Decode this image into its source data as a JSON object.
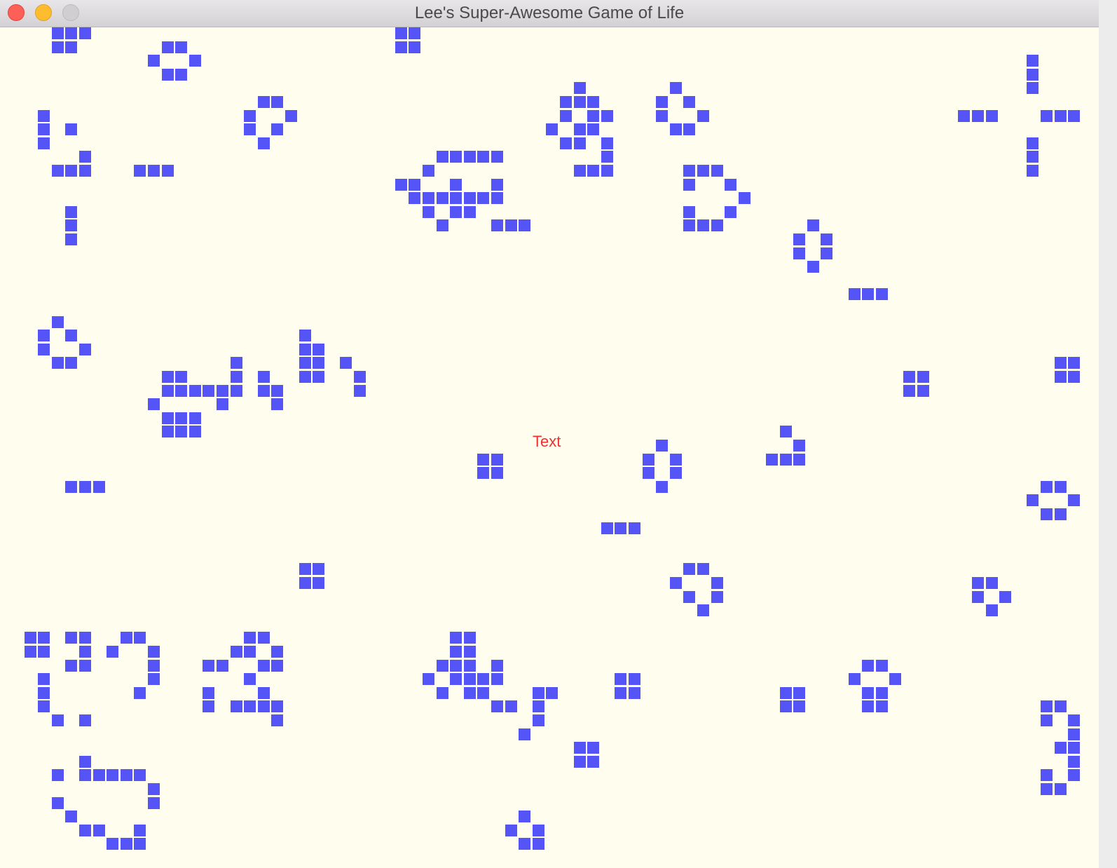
{
  "window": {
    "title": "Lee's Super-Awesome Game of Life"
  },
  "board": {
    "label_text": "Text",
    "background_color": "#fffeee",
    "cell_color": "#5555f7",
    "label_color": "#f03030",
    "live_cells": [
      [
        3,
        0
      ],
      [
        4,
        0
      ],
      [
        5,
        0
      ],
      [
        3,
        1
      ],
      [
        4,
        1
      ],
      [
        28,
        0
      ],
      [
        29,
        0
      ],
      [
        28,
        1
      ],
      [
        29,
        1
      ],
      [
        11,
        1
      ],
      [
        12,
        1
      ],
      [
        10,
        2
      ],
      [
        13,
        2
      ],
      [
        11,
        3
      ],
      [
        12,
        3
      ],
      [
        74,
        2
      ],
      [
        74,
        3
      ],
      [
        74,
        4
      ],
      [
        41,
        4
      ],
      [
        48,
        4
      ],
      [
        18,
        5
      ],
      [
        19,
        5
      ],
      [
        40,
        5
      ],
      [
        41,
        5
      ],
      [
        42,
        5
      ],
      [
        47,
        5
      ],
      [
        49,
        5
      ],
      [
        2,
        6
      ],
      [
        17,
        6
      ],
      [
        20,
        6
      ],
      [
        40,
        6
      ],
      [
        42,
        6
      ],
      [
        43,
        6
      ],
      [
        47,
        6
      ],
      [
        50,
        6
      ],
      [
        69,
        6
      ],
      [
        70,
        6
      ],
      [
        71,
        6
      ],
      [
        75,
        6
      ],
      [
        76,
        6
      ],
      [
        77,
        6
      ],
      [
        2,
        7
      ],
      [
        4,
        7
      ],
      [
        17,
        7
      ],
      [
        19,
        7
      ],
      [
        39,
        7
      ],
      [
        41,
        7
      ],
      [
        42,
        7
      ],
      [
        48,
        7
      ],
      [
        49,
        7
      ],
      [
        2,
        8
      ],
      [
        18,
        8
      ],
      [
        40,
        8
      ],
      [
        41,
        8
      ],
      [
        43,
        8
      ],
      [
        74,
        8
      ],
      [
        5,
        9
      ],
      [
        31,
        9
      ],
      [
        32,
        9
      ],
      [
        33,
        9
      ],
      [
        34,
        9
      ],
      [
        35,
        9
      ],
      [
        43,
        9
      ],
      [
        74,
        9
      ],
      [
        3,
        10
      ],
      [
        4,
        10
      ],
      [
        5,
        10
      ],
      [
        9,
        10
      ],
      [
        10,
        10
      ],
      [
        11,
        10
      ],
      [
        30,
        10
      ],
      [
        41,
        10
      ],
      [
        42,
        10
      ],
      [
        43,
        10
      ],
      [
        49,
        10
      ],
      [
        50,
        10
      ],
      [
        51,
        10
      ],
      [
        74,
        10
      ],
      [
        28,
        11
      ],
      [
        29,
        11
      ],
      [
        32,
        11
      ],
      [
        35,
        11
      ],
      [
        49,
        11
      ],
      [
        52,
        11
      ],
      [
        29,
        12
      ],
      [
        30,
        12
      ],
      [
        31,
        12
      ],
      [
        32,
        12
      ],
      [
        33,
        12
      ],
      [
        34,
        12
      ],
      [
        35,
        12
      ],
      [
        53,
        12
      ],
      [
        30,
        13
      ],
      [
        32,
        13
      ],
      [
        33,
        13
      ],
      [
        49,
        13
      ],
      [
        52,
        13
      ],
      [
        31,
        14
      ],
      [
        35,
        14
      ],
      [
        36,
        14
      ],
      [
        37,
        14
      ],
      [
        49,
        14
      ],
      [
        50,
        14
      ],
      [
        51,
        14
      ],
      [
        58,
        14
      ],
      [
        4,
        13
      ],
      [
        4,
        14
      ],
      [
        4,
        15
      ],
      [
        57,
        15
      ],
      [
        59,
        15
      ],
      [
        57,
        16
      ],
      [
        59,
        16
      ],
      [
        58,
        17
      ],
      [
        61,
        19
      ],
      [
        62,
        19
      ],
      [
        63,
        19
      ],
      [
        3,
        21
      ],
      [
        21,
        22
      ],
      [
        2,
        22
      ],
      [
        4,
        22
      ],
      [
        21,
        23
      ],
      [
        22,
        23
      ],
      [
        2,
        23
      ],
      [
        5,
        23
      ],
      [
        21,
        24
      ],
      [
        22,
        24
      ],
      [
        3,
        24
      ],
      [
        4,
        24
      ],
      [
        24,
        24
      ],
      [
        16,
        24
      ],
      [
        76,
        24
      ],
      [
        77,
        24
      ],
      [
        21,
        25
      ],
      [
        22,
        25
      ],
      [
        25,
        25
      ],
      [
        11,
        25
      ],
      [
        12,
        25
      ],
      [
        16,
        25
      ],
      [
        18,
        25
      ],
      [
        65,
        25
      ],
      [
        66,
        25
      ],
      [
        76,
        25
      ],
      [
        77,
        25
      ],
      [
        11,
        26
      ],
      [
        12,
        26
      ],
      [
        13,
        26
      ],
      [
        14,
        26
      ],
      [
        15,
        26
      ],
      [
        16,
        26
      ],
      [
        18,
        26
      ],
      [
        19,
        26
      ],
      [
        25,
        26
      ],
      [
        65,
        26
      ],
      [
        66,
        26
      ],
      [
        10,
        27
      ],
      [
        15,
        27
      ],
      [
        19,
        27
      ],
      [
        11,
        28
      ],
      [
        12,
        28
      ],
      [
        13,
        28
      ],
      [
        11,
        29
      ],
      [
        12,
        29
      ],
      [
        13,
        29
      ],
      [
        56,
        29
      ],
      [
        57,
        30
      ],
      [
        47,
        30
      ],
      [
        34,
        31
      ],
      [
        35,
        31
      ],
      [
        46,
        31
      ],
      [
        48,
        31
      ],
      [
        55,
        31
      ],
      [
        56,
        31
      ],
      [
        57,
        31
      ],
      [
        34,
        32
      ],
      [
        35,
        32
      ],
      [
        46,
        32
      ],
      [
        48,
        32
      ],
      [
        47,
        33
      ],
      [
        4,
        33
      ],
      [
        5,
        33
      ],
      [
        6,
        33
      ],
      [
        75,
        33
      ],
      [
        76,
        33
      ],
      [
        74,
        34
      ],
      [
        77,
        34
      ],
      [
        75,
        35
      ],
      [
        76,
        35
      ],
      [
        43,
        36
      ],
      [
        44,
        36
      ],
      [
        45,
        36
      ],
      [
        21,
        39
      ],
      [
        22,
        39
      ],
      [
        49,
        39
      ],
      [
        50,
        39
      ],
      [
        21,
        40
      ],
      [
        22,
        40
      ],
      [
        48,
        40
      ],
      [
        51,
        40
      ],
      [
        70,
        40
      ],
      [
        71,
        40
      ],
      [
        49,
        41
      ],
      [
        51,
        41
      ],
      [
        70,
        41
      ],
      [
        72,
        41
      ],
      [
        50,
        42
      ],
      [
        71,
        42
      ],
      [
        1,
        44
      ],
      [
        2,
        44
      ],
      [
        4,
        44
      ],
      [
        5,
        44
      ],
      [
        8,
        44
      ],
      [
        9,
        44
      ],
      [
        17,
        44
      ],
      [
        18,
        44
      ],
      [
        32,
        44
      ],
      [
        33,
        44
      ],
      [
        1,
        45
      ],
      [
        2,
        45
      ],
      [
        5,
        45
      ],
      [
        7,
        45
      ],
      [
        10,
        45
      ],
      [
        16,
        45
      ],
      [
        17,
        45
      ],
      [
        19,
        45
      ],
      [
        32,
        45
      ],
      [
        33,
        45
      ],
      [
        4,
        46
      ],
      [
        5,
        46
      ],
      [
        10,
        46
      ],
      [
        14,
        46
      ],
      [
        15,
        46
      ],
      [
        18,
        46
      ],
      [
        19,
        46
      ],
      [
        31,
        46
      ],
      [
        32,
        46
      ],
      [
        33,
        46
      ],
      [
        35,
        46
      ],
      [
        2,
        47
      ],
      [
        10,
        47
      ],
      [
        17,
        47
      ],
      [
        30,
        47
      ],
      [
        32,
        47
      ],
      [
        33,
        47
      ],
      [
        34,
        47
      ],
      [
        35,
        47
      ],
      [
        44,
        47
      ],
      [
        45,
        47
      ],
      [
        2,
        48
      ],
      [
        9,
        48
      ],
      [
        14,
        48
      ],
      [
        18,
        48
      ],
      [
        31,
        48
      ],
      [
        33,
        48
      ],
      [
        34,
        48
      ],
      [
        38,
        48
      ],
      [
        39,
        48
      ],
      [
        44,
        48
      ],
      [
        45,
        48
      ],
      [
        56,
        48
      ],
      [
        57,
        48
      ],
      [
        62,
        48
      ],
      [
        63,
        48
      ],
      [
        61,
        47
      ],
      [
        64,
        47
      ],
      [
        62,
        46
      ],
      [
        63,
        46
      ],
      [
        2,
        49
      ],
      [
        14,
        49
      ],
      [
        16,
        49
      ],
      [
        17,
        49
      ],
      [
        18,
        49
      ],
      [
        19,
        49
      ],
      [
        35,
        49
      ],
      [
        36,
        49
      ],
      [
        38,
        49
      ],
      [
        56,
        49
      ],
      [
        57,
        49
      ],
      [
        62,
        49
      ],
      [
        63,
        49
      ],
      [
        75,
        49
      ],
      [
        76,
        49
      ],
      [
        3,
        50
      ],
      [
        5,
        50
      ],
      [
        19,
        50
      ],
      [
        38,
        50
      ],
      [
        75,
        50
      ],
      [
        77,
        50
      ],
      [
        37,
        51
      ],
      [
        77,
        51
      ],
      [
        41,
        52
      ],
      [
        42,
        52
      ],
      [
        76,
        52
      ],
      [
        77,
        52
      ],
      [
        5,
        53
      ],
      [
        41,
        53
      ],
      [
        42,
        53
      ],
      [
        77,
        53
      ],
      [
        3,
        54
      ],
      [
        5,
        54
      ],
      [
        6,
        54
      ],
      [
        7,
        54
      ],
      [
        8,
        54
      ],
      [
        9,
        54
      ],
      [
        75,
        54
      ],
      [
        77,
        54
      ],
      [
        10,
        55
      ],
      [
        75,
        55
      ],
      [
        76,
        55
      ],
      [
        3,
        56
      ],
      [
        10,
        56
      ],
      [
        4,
        57
      ],
      [
        37,
        57
      ],
      [
        5,
        58
      ],
      [
        6,
        58
      ],
      [
        9,
        58
      ],
      [
        36,
        58
      ],
      [
        38,
        58
      ],
      [
        7,
        59
      ],
      [
        8,
        59
      ],
      [
        9,
        59
      ],
      [
        37,
        59
      ],
      [
        38,
        59
      ]
    ]
  }
}
